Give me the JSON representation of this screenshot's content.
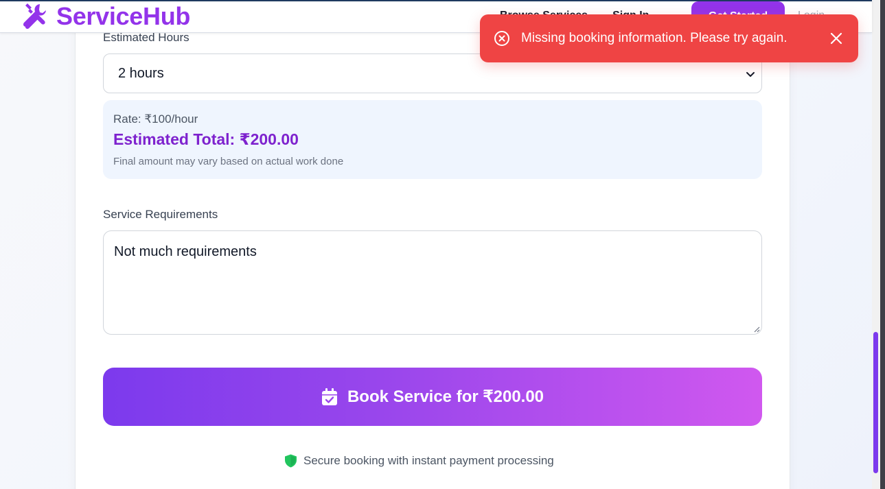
{
  "navbar": {
    "brand": "ServiceHub",
    "links": [
      "Browse Services",
      "Sign In"
    ],
    "cta_label": "Get Started",
    "login_label": "Login"
  },
  "form": {
    "hours_label": "Estimated Hours",
    "hours_value": "2 hours",
    "rate_text": "Rate: ₹100/hour",
    "estimated_total": "Estimated Total: ₹200.00",
    "rate_note": "Final amount may vary based on actual work done",
    "requirements_label": "Service Requirements",
    "requirements_value": "Not much requirements",
    "book_button_label": "Book Service for ₹200.00",
    "secure_note": "Secure booking with instant payment processing"
  },
  "toast": {
    "message": "Missing booking information. Please try again.",
    "type": "error"
  },
  "colors": {
    "brand": "#9333ea",
    "accent_total": "#7e22ce",
    "toast_bg": "#ef4444",
    "button_gradient_start": "#7c3aed",
    "button_gradient_end": "#d058ef",
    "shield": "#22c55e",
    "rate_box_bg": "#eff5fe"
  },
  "icons": {
    "brand": "tools-icon",
    "toast": "x-circle-icon",
    "toast_close": "close-icon",
    "book": "calendar-check-icon",
    "secure": "shield-check-icon",
    "select": "chevron-down-icon"
  }
}
